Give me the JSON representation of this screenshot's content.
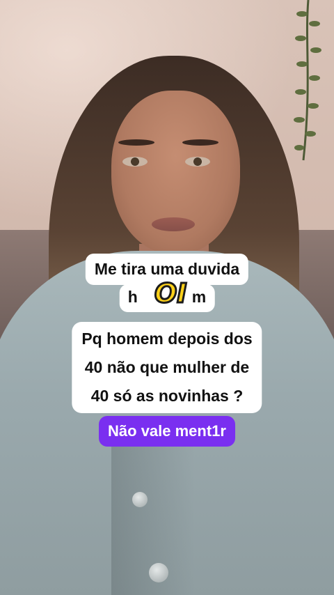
{
  "captions": {
    "line1": "Me tira uma duvida",
    "line2_before": "h",
    "line2_after": "m",
    "sticker": "OI",
    "question_l1": "Pq homem depois dos",
    "question_l2": "40 não que mulher de",
    "question_l3": "40 só as novinhas ?",
    "badge": "Não vale ment1r"
  },
  "colors": {
    "badge_bg": "#7a2ff0",
    "caption_bg": "#ffffff",
    "sticker": "#ffd11a"
  }
}
